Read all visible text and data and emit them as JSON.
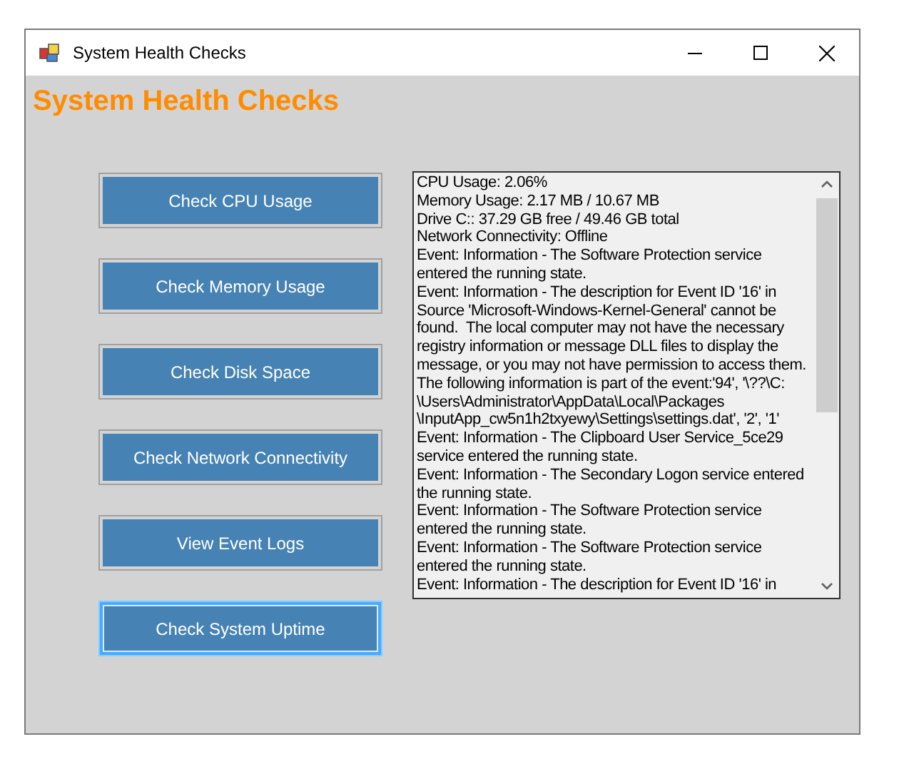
{
  "window": {
    "title": "System Health Checks"
  },
  "heading": "System Health Checks",
  "buttons": [
    {
      "label": "Check CPU Usage",
      "focused": false
    },
    {
      "label": "Check Memory Usage",
      "focused": false
    },
    {
      "label": "Check Disk Space",
      "focused": false
    },
    {
      "label": "Check Network Connectivity",
      "focused": false
    },
    {
      "label": "View Event Logs",
      "focused": false
    },
    {
      "label": "Check System Uptime",
      "focused": true
    }
  ],
  "output_lines": [
    "CPU Usage: 2.06%",
    "Memory Usage: 2.17 MB / 10.67 MB",
    "Drive C:: 37.29 GB free / 49.46 GB total",
    "Network Connectivity: Offline",
    "Event: Information - The Software Protection service",
    "entered the running state.",
    "Event: Information - The description for Event ID '16' in",
    "Source 'Microsoft-Windows-Kernel-General' cannot be",
    "found.  The local computer may not have the necessary",
    "registry information or message DLL files to display the",
    "message, or you may not have permission to access them.",
    "The following information is part of the event:'94', '\\??\\C:",
    "\\Users\\Administrator\\AppData\\Local\\Packages",
    "\\InputApp_cw5n1h2txyewy\\Settings\\settings.dat', '2', '1'",
    "Event: Information - The Clipboard User Service_5ce29",
    "service entered the running state.",
    "Event: Information - The Secondary Logon service entered",
    "the running state.",
    "Event: Information - The Software Protection service",
    "entered the running state.",
    "Event: Information - The Software Protection service",
    "entered the running state.",
    "Event: Information - The description for Event ID '16' in"
  ]
}
